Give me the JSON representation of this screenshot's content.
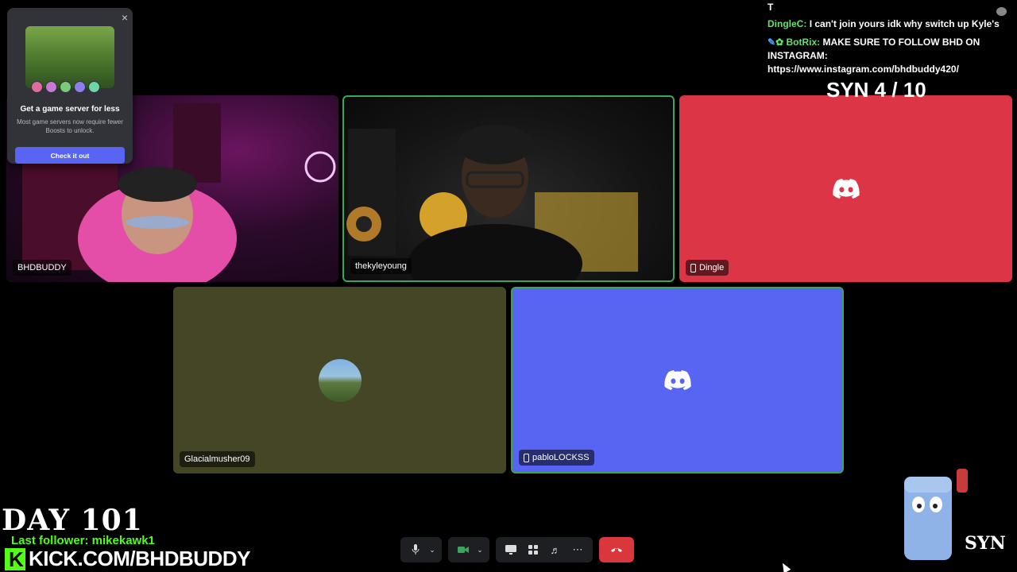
{
  "promo": {
    "title": "Get a game server for less",
    "description": "Most game servers now require fewer Boosts to unlock.",
    "cta_label": "Check it out",
    "close_label": "×"
  },
  "tiles": {
    "bhd": {
      "name": "BHDBUDDY"
    },
    "kyle": {
      "name": "thekyleyoung"
    },
    "dingle": {
      "name": "Dingle"
    },
    "glacial": {
      "name": "Glacialmusher09"
    },
    "pablo": {
      "name": "pabloLOCKSS"
    }
  },
  "chat": {
    "top_line": "T",
    "messages": [
      {
        "user": "DingleC:",
        "text": "I can't join yours idk why switch up Kyle's"
      },
      {
        "user": "BotRix:",
        "text": "MAKE SURE TO FOLLOW BHD ON INSTAGRAM: https://www.instagram.com/bhdbuddy420/"
      }
    ]
  },
  "overlay": {
    "syn_counter": "SYN 4 / 10",
    "day": "DAY 101",
    "last_follower": "Last follower: mikekawk1",
    "kick_url": "KICK.COM/BHDBUDDY",
    "brand_logo": "SYN"
  },
  "colors": {
    "dingle_tile": "#dc3545",
    "pablo_tile": "#5865f2",
    "glacial_tile": "#444626",
    "speaking_border": "#3ba55d",
    "leave_button": "#da373c",
    "kick_green": "#53fc18"
  },
  "controls": {
    "icons": [
      "microphone-icon",
      "chevron-down-icon",
      "camera-icon",
      "chevron-down-icon",
      "screen-share-icon",
      "activities-icon",
      "soundboard-icon",
      "more-icon",
      "leave-call-icon"
    ]
  }
}
